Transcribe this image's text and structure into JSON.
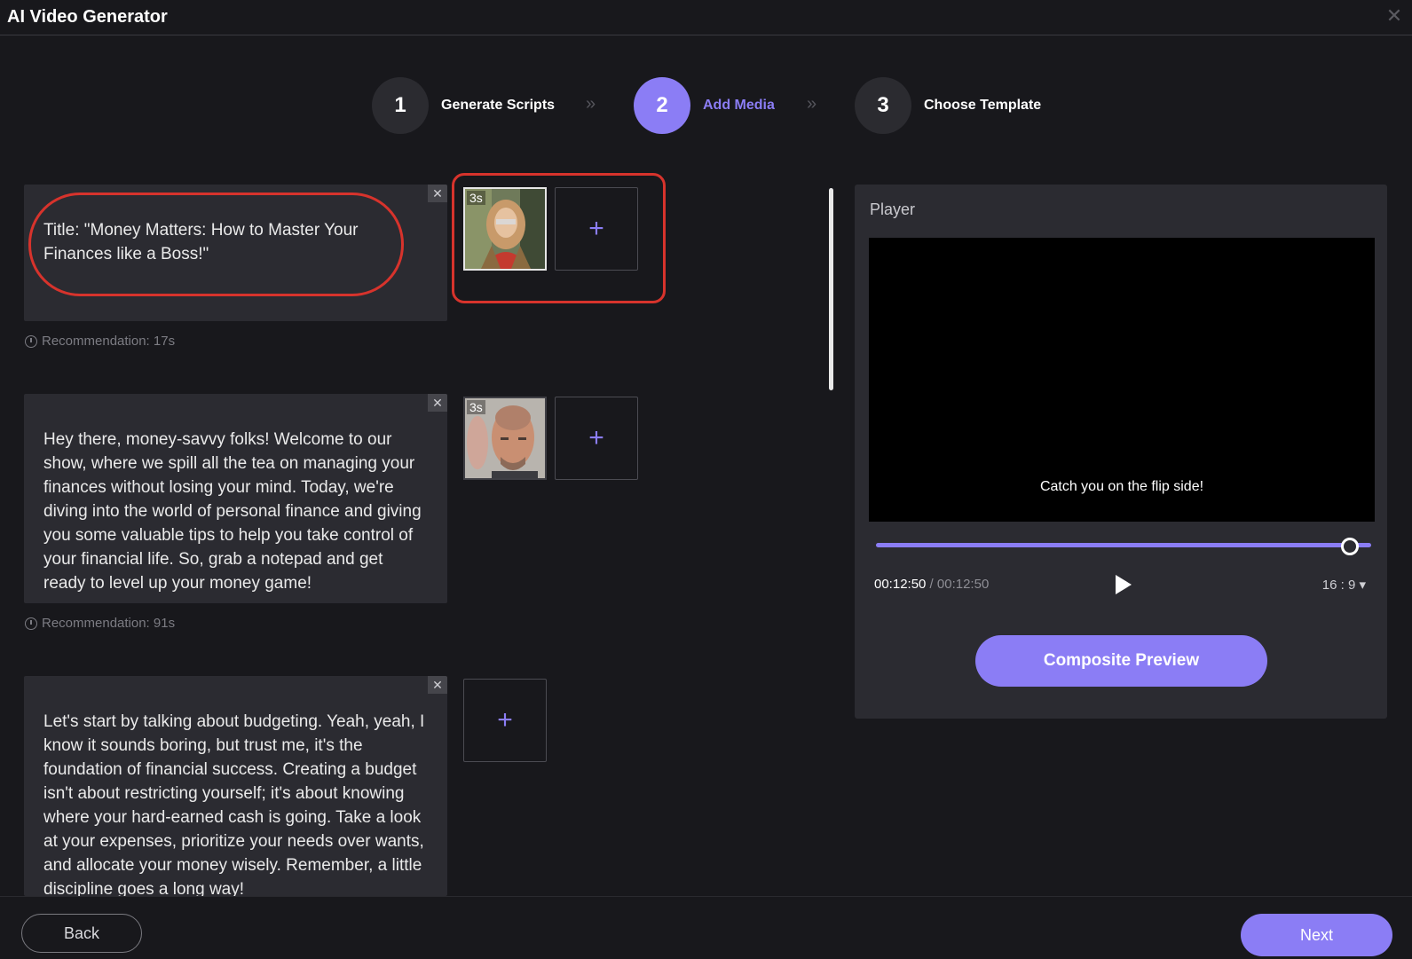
{
  "app": {
    "title": "AI Video Generator"
  },
  "steps": [
    {
      "number": "1",
      "label": "Generate Scripts",
      "active": false
    },
    {
      "number": "2",
      "label": "Add Media",
      "active": true
    },
    {
      "number": "3",
      "label": "Choose Template",
      "active": false
    }
  ],
  "scripts": [
    {
      "text": "Title: \"Money Matters: How to Master Your Finances like a Boss!\"",
      "recommendation": "Recommendation: 17s",
      "media_duration": "3s"
    },
    {
      "text": "Hey there, money-savvy folks! Welcome to our show, where we spill all the tea on managing your finances without losing your mind. Today, we're diving into the world of personal finance and giving you some valuable tips to help you take control of your financial life. So, grab a notepad and get ready to level up your money game!",
      "recommendation": "Recommendation: 91s",
      "media_duration": "3s"
    },
    {
      "text": "Let's start by talking about budgeting. Yeah, yeah, I know it sounds boring, but trust me, it's the foundation of financial success. Creating a budget isn't about restricting yourself; it's about knowing where your hard-earned cash is going. Take a look at your expenses, prioritize your needs over wants, and allocate your money wisely. Remember, a little discipline goes a long way!"
    }
  ],
  "player": {
    "title": "Player",
    "subtitle": "Catch you on the flip side!",
    "current_time": "00:12:50",
    "total_time": " / 00:12:50",
    "progress": 1.0,
    "aspect_ratio": "16 : 9 ▾",
    "composite_label": "Composite Preview"
  },
  "icons": {
    "add": "+",
    "close": "✕",
    "chevron": "»"
  },
  "footer": {
    "back": "Back",
    "next": "Next"
  },
  "colors": {
    "accent": "#8b7df5",
    "highlight": "#d7332c",
    "background": "#18181c",
    "panel": "#2b2b31"
  }
}
